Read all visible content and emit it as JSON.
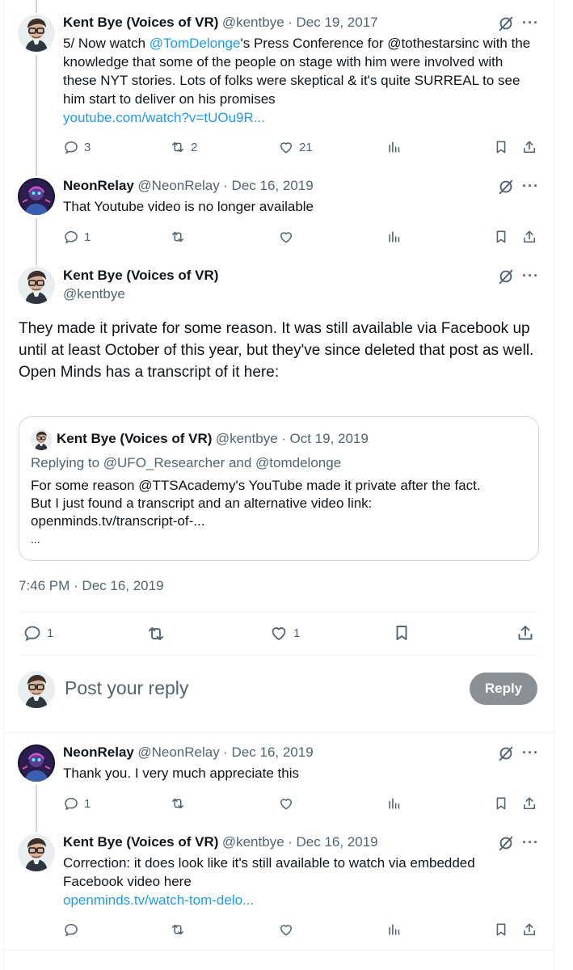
{
  "tweets": [
    {
      "name": "Kent Bye (Voices of VR)",
      "handle": "@kentbye",
      "date": "· Dec 19, 2017",
      "text_pre": "5/ Now watch ",
      "mention": "@TomDelonge",
      "text_post": "'s Press Conference for @tothestarsinc with the knowledge that some of the people on stage with him were involved with these NYT stories. Lots of folks were skeptical & it's quite SURREAL to see him start to deliver on his promises",
      "link": "youtube.com/watch?v=tUOu9R...",
      "replies": "3",
      "reposts": "2",
      "likes": "21"
    },
    {
      "name": "NeonRelay",
      "handle": "@NeonRelay",
      "date": "· Dec 16, 2019",
      "text": "That Youtube video is no longer available",
      "replies": "1"
    }
  ],
  "main": {
    "name": "Kent Bye (Voices of VR)",
    "handle": "@kentbye",
    "text1": "They made it private for some reason. It was still available via Facebook up until at least October of this year, but they've since deleted that post as well.",
    "text2": "Open Minds has a transcript of it here:",
    "timestamp": "7:46 PM · Dec 16, 2019",
    "replies": "1",
    "likes": "1"
  },
  "quote": {
    "name": "Kent Bye (Voices of VR)",
    "handle": "@kentbye",
    "date": "· Oct 19, 2019",
    "replying": "Replying to @UFO_Researcher and @tomdelonge",
    "line1": "For some reason @TTSAcademy's YouTube made it private after the fact.",
    "line2": "But I just found a transcript and an alternative video link:",
    "line3": "openminds.tv/transcript-of-...",
    "line4": "..."
  },
  "compose": {
    "placeholder": "Post your reply",
    "button": "Reply"
  },
  "replies": [
    {
      "name": "NeonRelay",
      "handle": "@NeonRelay",
      "date": "· Dec 16, 2019",
      "text": "Thank you. I very much appreciate this",
      "replies": "1"
    },
    {
      "name": "Kent Bye (Voices of VR)",
      "handle": "@kentbye",
      "date": "· Dec 16, 2019",
      "text": "Correction: it does look like it's still available to watch via embedded Facebook video here",
      "link": "openminds.tv/watch-tom-delo..."
    }
  ],
  "icons": {
    "more": "···"
  },
  "colors": {
    "link": "#1d9bf0",
    "muted": "#536471",
    "border": "#cfd9de",
    "reply_button": "#8b9095"
  }
}
